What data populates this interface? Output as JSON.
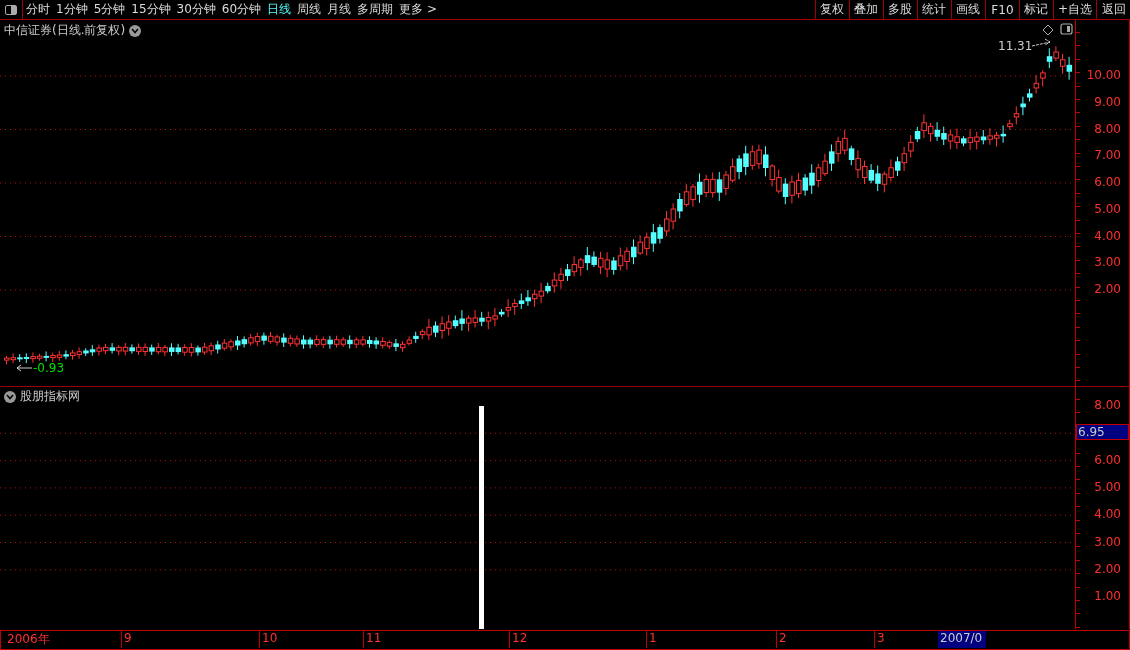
{
  "toolbar": {
    "periods": [
      {
        "label": "分时",
        "selected": false
      },
      {
        "label": "1分钟",
        "selected": false
      },
      {
        "label": "5分钟",
        "selected": false
      },
      {
        "label": "15分钟",
        "selected": false
      },
      {
        "label": "30分钟",
        "selected": false
      },
      {
        "label": "60分钟",
        "selected": false
      },
      {
        "label": "日线",
        "selected": true
      },
      {
        "label": "周线",
        "selected": false
      },
      {
        "label": "月线",
        "selected": false
      },
      {
        "label": "多周期",
        "selected": false
      },
      {
        "label": "更多 >",
        "selected": false
      }
    ],
    "actions": [
      "复权",
      "叠加",
      "多股",
      "统计",
      "画线",
      "F10",
      "标记",
      "+自选",
      "返回"
    ]
  },
  "chart": {
    "title": "中信证券(日线.前复权)",
    "high_label": "11.31",
    "low_label": "-0.93",
    "y_ticks": [
      "10.00",
      "9.00",
      "8.00",
      "7.00",
      "6.00",
      "5.00",
      "4.00",
      "3.00",
      "2.00"
    ]
  },
  "indicator": {
    "title": "股朋指标网",
    "y_ticks": [
      "8.00",
      "6.00",
      "5.00",
      "4.00",
      "3.00",
      "2.00",
      "1.00"
    ],
    "current_value": "6.95"
  },
  "time_axis": {
    "labels": [
      "2006年",
      "9",
      "10",
      "11",
      "12",
      "1",
      "2",
      "3"
    ],
    "current": "2007/0"
  }
}
